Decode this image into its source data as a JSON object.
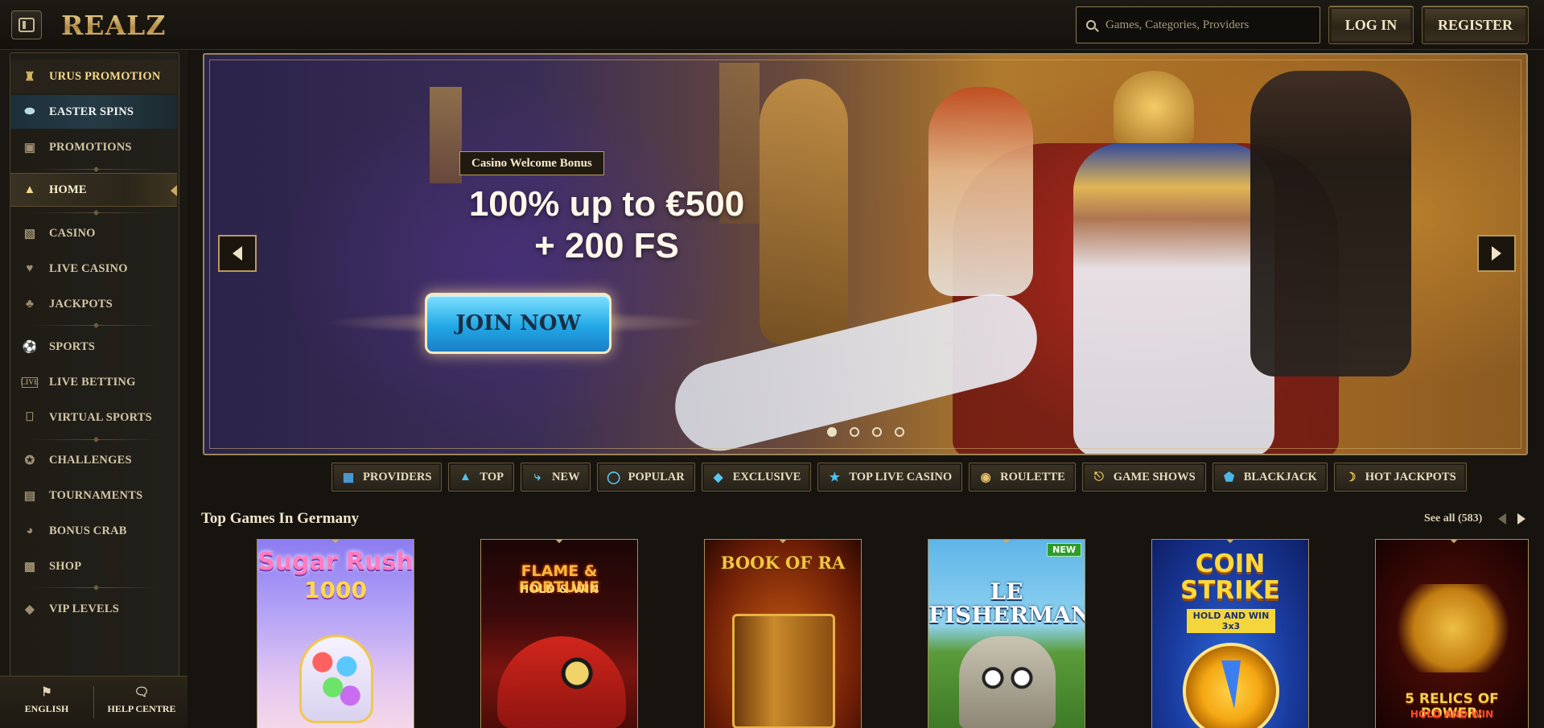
{
  "header": {
    "logo": "REALZ",
    "search_placeholder": "Games, Categories, Providers",
    "login": "LOG IN",
    "register": "REGISTER"
  },
  "sidebar": {
    "items": [
      {
        "label": "URUS PROMOTION",
        "icon": "car-icon"
      },
      {
        "label": "EASTER SPINS",
        "icon": "egg-icon"
      },
      {
        "label": "PROMOTIONS",
        "icon": "gift-icon"
      },
      {
        "label": "HOME",
        "icon": "pyramid-icon"
      },
      {
        "label": "CASINO",
        "icon": "slot-machine-icon"
      },
      {
        "label": "LIVE CASINO",
        "icon": "cards-icon"
      },
      {
        "label": "JACKPOTS",
        "icon": "clover-icon"
      },
      {
        "label": "SPORTS",
        "icon": "ball-icon"
      },
      {
        "label": "LIVE BETTING",
        "icon": "live-icon"
      },
      {
        "label": "VIRTUAL SPORTS",
        "icon": "virtual-icon"
      },
      {
        "label": "CHALLENGES",
        "icon": "medal-icon"
      },
      {
        "label": "TOURNAMENTS",
        "icon": "podium-icon"
      },
      {
        "label": "BONUS CRAB",
        "icon": "crab-icon"
      },
      {
        "label": "SHOP",
        "icon": "bag-icon"
      },
      {
        "label": "VIP LEVELS",
        "icon": "diamond-icon"
      }
    ],
    "language": "ENGLISH",
    "help": "HELP CENTRE"
  },
  "banner": {
    "tag": "Casino Welcome Bonus",
    "title_line1": "100% up to €500",
    "title_line2": "+ 200 FS",
    "cta": "JOIN NOW",
    "slides": 4,
    "active_slide": 1
  },
  "categories": [
    {
      "label": "PROVIDERS",
      "icon": "cards-icon"
    },
    {
      "label": "TOP",
      "icon": "pyramid-icon"
    },
    {
      "label": "NEW",
      "icon": "lightning-icon"
    },
    {
      "label": "POPULAR",
      "icon": "flame-icon"
    },
    {
      "label": "EXCLUSIVE",
      "icon": "gem-icon"
    },
    {
      "label": "TOP LIVE CASINO",
      "icon": "star-icon"
    },
    {
      "label": "ROULETTE",
      "icon": "roulette-icon"
    },
    {
      "label": "GAME SHOWS",
      "icon": "microphone-icon"
    },
    {
      "label": "BLACKJACK",
      "icon": "chip-icon"
    },
    {
      "label": "HOT JACKPOTS",
      "icon": "banana-icon"
    }
  ],
  "section": {
    "title": "Top Games In Germany",
    "see_all": "See all (583)"
  },
  "games": [
    {
      "title": "Sugar Rush",
      "sub": "1000",
      "badge": ""
    },
    {
      "title": "FLAME & FORTUNE",
      "sub": "HOLD & WIN",
      "badge": ""
    },
    {
      "title": "BOOK OF RA",
      "sub": "",
      "badge": ""
    },
    {
      "title": "LE FISHERMAN",
      "sub": "",
      "badge": "NEW"
    },
    {
      "title": "COIN STRIKE",
      "sub": "HOLD AND WIN 3x3",
      "badge": ""
    },
    {
      "title": "5 RELICS OF POWER:",
      "sub": "HOLD AND WIN",
      "badge": ""
    }
  ],
  "colors": {
    "accent_gold": "#c9a964",
    "background": "#17140f",
    "join_blue": "#22a8e6"
  }
}
